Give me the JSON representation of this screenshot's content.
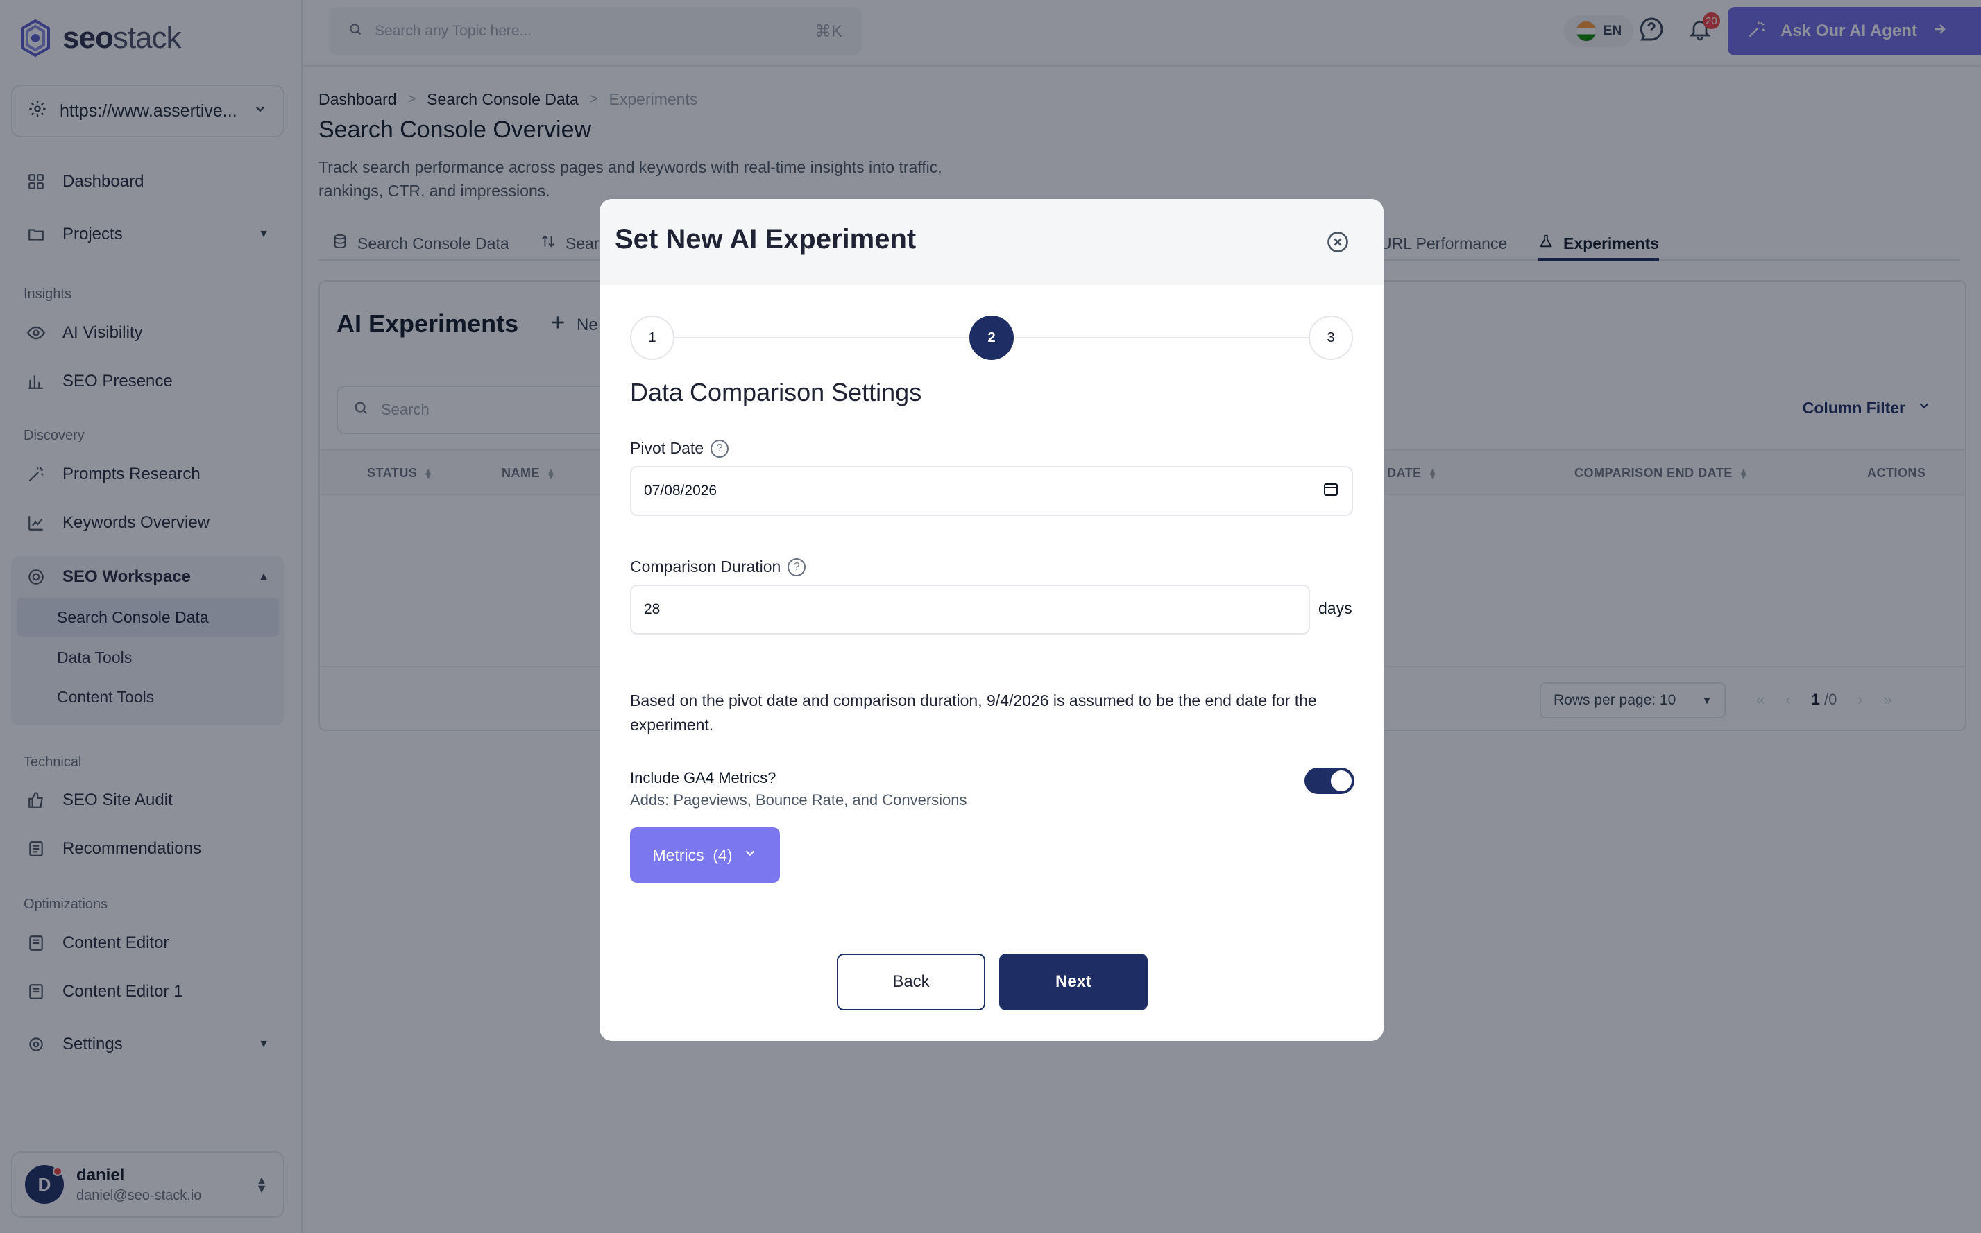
{
  "brand": {
    "name_bold": "seo",
    "name_light": "stack"
  },
  "sidebar": {
    "site": "https://www.assertive...",
    "items_top": [
      {
        "label": "Dashboard",
        "icon": "grid-icon"
      },
      {
        "label": "Projects",
        "icon": "folder-icon"
      }
    ],
    "sections": {
      "insights": "Insights",
      "discovery": "Discovery",
      "technical": "Technical",
      "optimizations": "Optimizations"
    },
    "insights_items": [
      {
        "label": "AI Visibility",
        "icon": "eye-icon"
      },
      {
        "label": "SEO Presence",
        "icon": "bar-chart-icon"
      }
    ],
    "discovery_items": [
      {
        "label": "Prompts Research",
        "icon": "wand-icon"
      },
      {
        "label": "Keywords Overview",
        "icon": "trend-icon"
      }
    ],
    "workspace": {
      "label": "SEO Workspace",
      "sub_items": [
        "Search Console Data",
        "Data Tools",
        "Content Tools"
      ]
    },
    "technical_items": [
      {
        "label": "SEO Site Audit",
        "icon": "thumbs-up-icon"
      },
      {
        "label": "Recommendations",
        "icon": "list-icon"
      }
    ],
    "optimization_items": [
      {
        "label": "Content Editor",
        "icon": "doc-icon"
      },
      {
        "label": "Content Editor 1",
        "icon": "doc-icon"
      }
    ],
    "settings": "Settings",
    "user": {
      "initial": "D",
      "name": "daniel",
      "email": "daniel@seo-stack.io"
    }
  },
  "topbar": {
    "search_placeholder": "Search any Topic here...",
    "shortcut": "⌘K",
    "lang": "EN",
    "notifications": "20",
    "agent_button": "Ask Our AI Agent"
  },
  "breadcrumb": [
    "Dashboard",
    "Search Console Data",
    "Experiments"
  ],
  "page": {
    "title": "Search Console Overview",
    "description": "Track search performance across pages and keywords with real-time insights into traffic, rankings, CTR, and impressions."
  },
  "tabs": [
    {
      "label": "Search Console Data",
      "icon": "database-icon"
    },
    {
      "label": "Sear",
      "icon": "compare-icon"
    },
    {
      "label": "URL Performance",
      "icon": ""
    },
    {
      "label": "Experiments",
      "icon": "flask-icon",
      "active": true
    }
  ],
  "panel": {
    "title": "AI Experiments",
    "new_label": "Ne",
    "search_placeholder": "Search",
    "column_filter": "Column Filter",
    "columns": [
      "STATUS",
      "NAME",
      "DATE",
      "COMPARISON END DATE",
      "ACTIONS"
    ],
    "rows_per_page": "Rows per page: 10",
    "page": "1",
    "page_total": "/0"
  },
  "modal": {
    "title": "Set New AI Experiment",
    "steps": [
      "1",
      "2",
      "3"
    ],
    "active_step": 2,
    "section_title": "Data Comparison Settings",
    "pivot_label": "Pivot Date",
    "pivot_value": "07/08/2026",
    "duration_label": "Comparison Duration",
    "duration_value": "28",
    "duration_unit": "days",
    "note": "Based on the pivot date and comparison duration, 9/4/2026 is assumed to be the end date for the experiment.",
    "ga4_label": "Include GA4 Metrics?",
    "ga4_sub": "Adds: Pageviews, Bounce Rate, and Conversions",
    "ga4_enabled": true,
    "metrics_button": "Metrics  (4)",
    "back": "Back",
    "next": "Next"
  },
  "colors": {
    "primary": "#1e2d64",
    "accent": "#7b77ee",
    "agent": "#6f6be6"
  }
}
